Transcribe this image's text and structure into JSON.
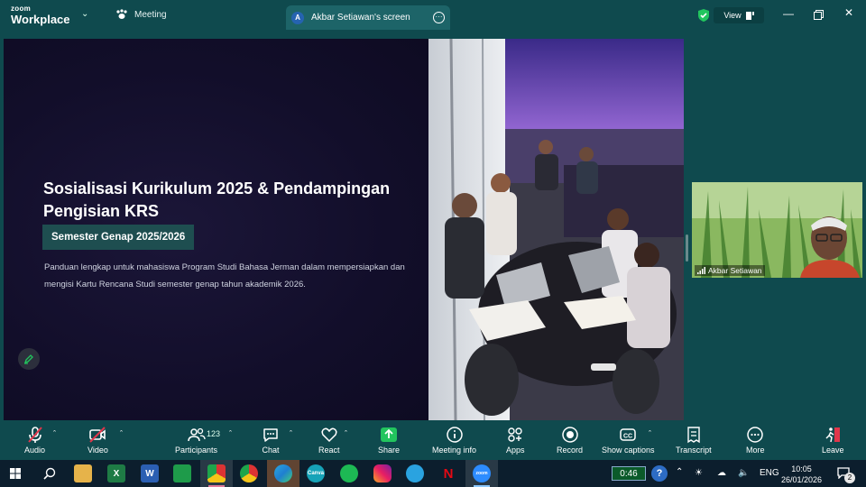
{
  "titlebar": {
    "brand_top": "zoom",
    "brand_bottom": "Workplace",
    "meeting_label": "Meeting",
    "screen_tab_avatar": "A",
    "screen_tab_title": "Akbar Setiawan's screen",
    "view_label": "View"
  },
  "slide": {
    "title": "Sosialisasi Kurikulum 2025 & Pendampingan Pengisian KRS",
    "badge": "Semester Genap 2025/2026",
    "description": "Panduan lengkap untuk mahasiswa Program Studi Bahasa Jerman dalam mempersiapkan dan mengisi Kartu Rencana Studi semester genap tahun akademik 2026."
  },
  "participant": {
    "name": "Akbar Setiawan"
  },
  "controls": {
    "audio": "Audio",
    "video": "Video",
    "participants": "Participants",
    "participants_count": "123",
    "chat": "Chat",
    "react": "React",
    "share": "Share",
    "meeting_info": "Meeting info",
    "apps": "Apps",
    "record": "Record",
    "show_captions": "Show captions",
    "transcript": "Transcript",
    "more": "More",
    "leave": "Leave"
  },
  "taskbar": {
    "recording_timer": "0:46",
    "language": "ENG",
    "time": "10:05",
    "date": "26/01/2026",
    "notification_count": "2"
  },
  "colors": {
    "zoom_teal": "#0f4a4e",
    "share_green": "#22c55e",
    "muted_red": "#e0364b"
  }
}
